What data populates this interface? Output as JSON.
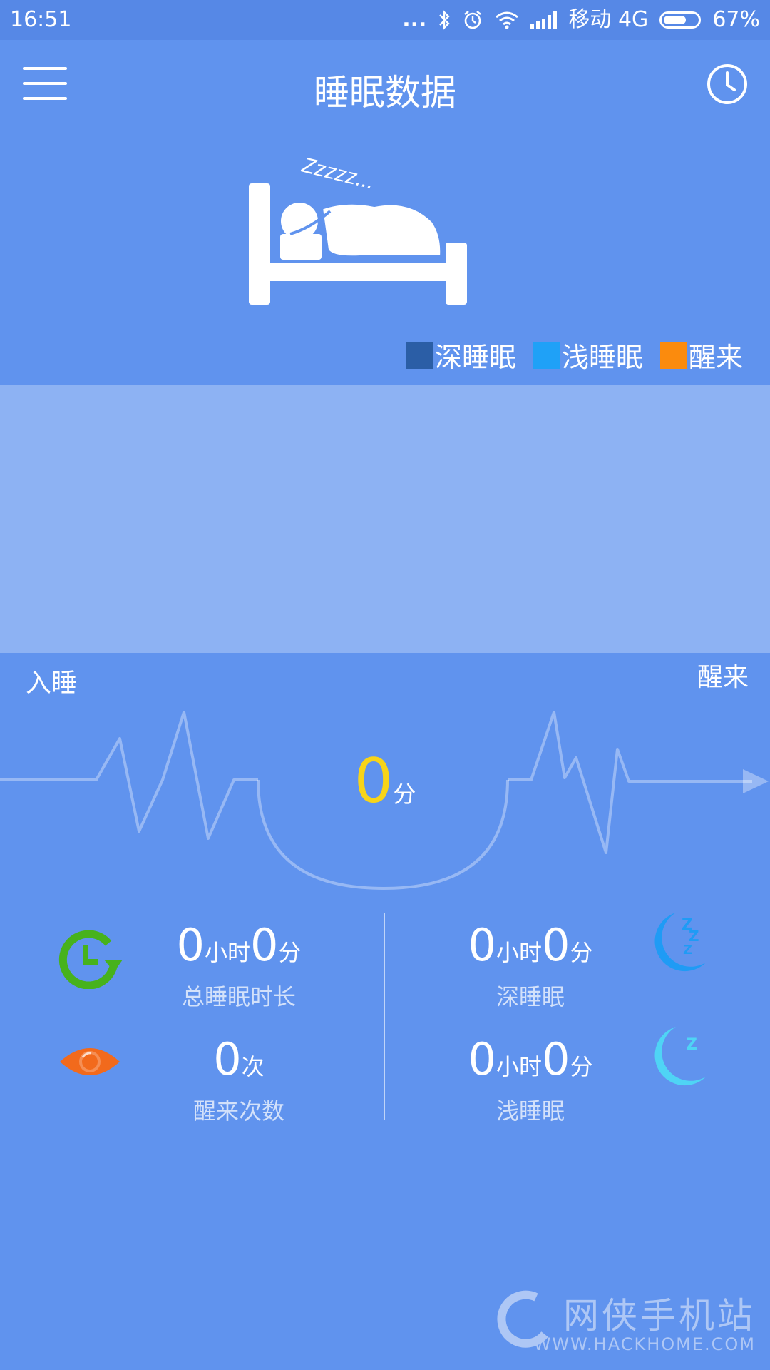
{
  "status_bar": {
    "time": "16:51",
    "dots": "...",
    "carrier": "移动 4G",
    "battery": "67%",
    "battery_level": 0.67
  },
  "header": {
    "title": "睡眠数据"
  },
  "legend": [
    {
      "label": "深睡眠",
      "color": "#2b5ea6"
    },
    {
      "label": "浅睡眠",
      "color": "#1fa1f7"
    },
    {
      "label": "醒来",
      "color": "#fb8b0d"
    }
  ],
  "timeline": {
    "start_label": "入睡",
    "end_label": "醒来"
  },
  "score": {
    "value": "0",
    "unit": "分"
  },
  "stats": {
    "total": {
      "hours": "0",
      "hours_unit": "小时",
      "minutes": "0",
      "minutes_unit": "分",
      "label": "总睡眠时长"
    },
    "deep": {
      "hours": "0",
      "hours_unit": "小时",
      "minutes": "0",
      "minutes_unit": "分",
      "label": "深睡眠"
    },
    "wake": {
      "count": "0",
      "count_unit": "次",
      "label": "醒来次数"
    },
    "light": {
      "hours": "0",
      "hours_unit": "小时",
      "minutes": "0",
      "minutes_unit": "分",
      "label": "浅睡眠"
    }
  },
  "watermark": {
    "cn": "网侠手机站",
    "en": "WWW.HACKHOME.COM"
  },
  "bed_illustration": {
    "snore_text": "Zzzzz..."
  },
  "colors": {
    "background": "#6093ee",
    "chart_area": "#8db2f3",
    "score": "#f7d419",
    "total_icon": "#47b21c",
    "wake_icon": "#f26a1c",
    "deep_moon": "#1f9bf5",
    "light_moon": "#4fd4f5"
  }
}
